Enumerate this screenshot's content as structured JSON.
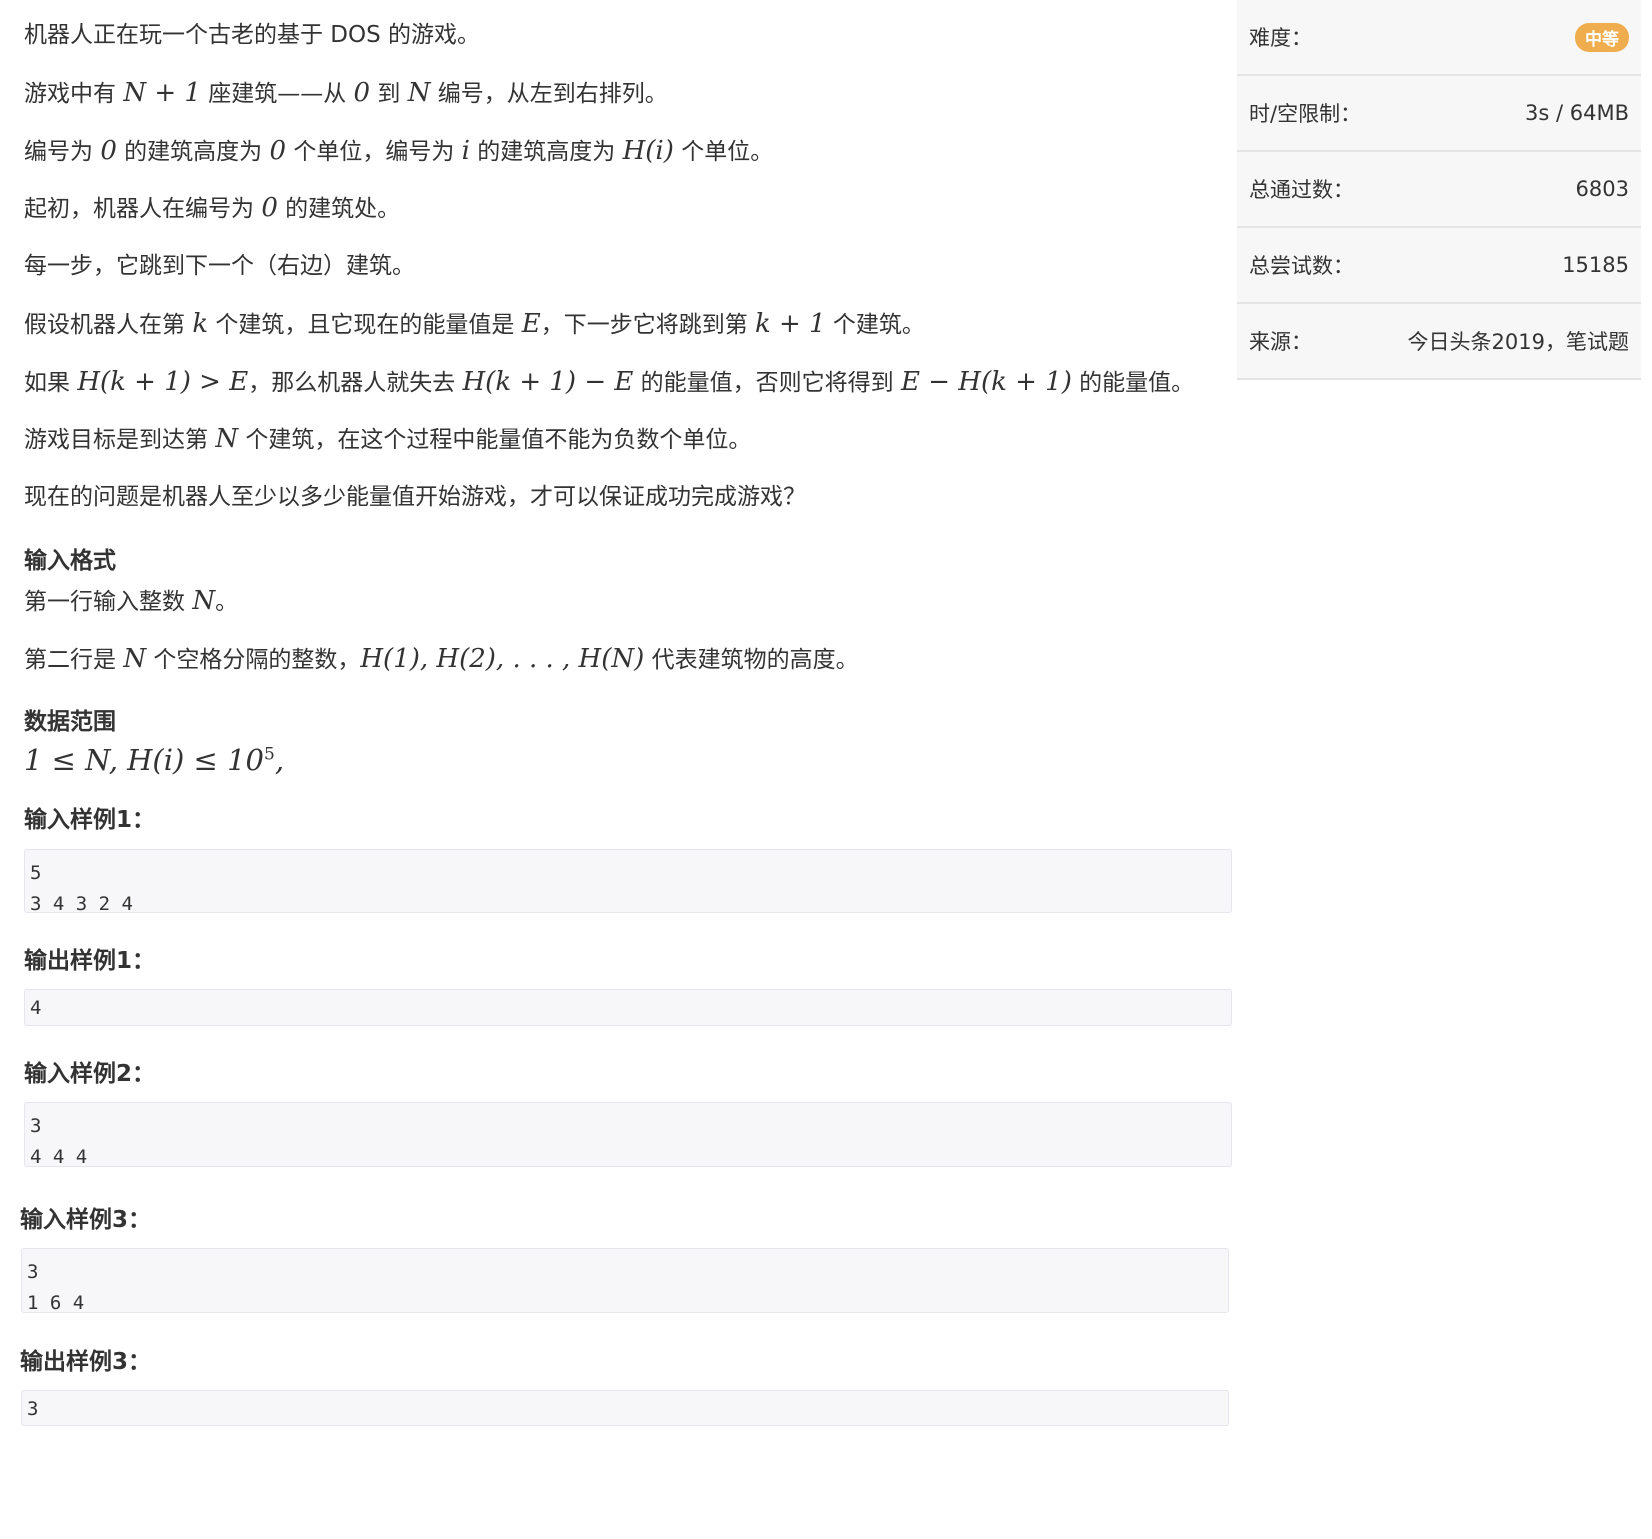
{
  "problem": {
    "p1": "机器人正在玩一个古老的基于 DOS 的游戏。",
    "p2_a": "游戏中有 ",
    "p2_m1": "N + 1",
    "p2_b": " 座建筑——从 ",
    "p2_m2": "0",
    "p2_c": " 到 ",
    "p2_m3": "N",
    "p2_d": " 编号，从左到右排列。",
    "p3_a": "编号为 ",
    "p3_m1": "0",
    "p3_b": " 的建筑高度为 ",
    "p3_m2": "0",
    "p3_c": " 个单位，编号为 ",
    "p3_m3": "i",
    "p3_d": " 的建筑高度为 ",
    "p3_m4": "H(i)",
    "p3_e": " 个单位。",
    "p4_a": "起初，机器人在编号为 ",
    "p4_m1": "0",
    "p4_b": " 的建筑处。",
    "p5": "每一步，它跳到下一个（右边）建筑。",
    "p6_a": "假设机器人在第 ",
    "p6_m1": "k",
    "p6_b": " 个建筑，且它现在的能量值是 ",
    "p6_m2": "E",
    "p6_c": "，下一步它将跳到第 ",
    "p6_m3": "k + 1",
    "p6_d": " 个建筑。",
    "p7_a": "如果 ",
    "p7_m1": "H(k + 1) > E",
    "p7_b": "，那么机器人就失去 ",
    "p7_m2": "H(k + 1) − E",
    "p7_c": " 的能量值，否则它将得到 ",
    "p7_m3": "E − H(k + 1)",
    "p7_d": " 的能量值。",
    "p8_a": "游戏目标是到达第 ",
    "p8_m1": "N",
    "p8_b": " 个建筑，在这个过程中能量值不能为负数个单位。",
    "p9": "现在的问题是机器人至少以多少能量值开始游戏，才可以保证成功完成游戏？",
    "h_input": "输入格式",
    "in1_a": "第一行输入整数 ",
    "in1_m1": "N",
    "in1_b": "。",
    "in2_a": "第二行是 ",
    "in2_m1": "N",
    "in2_b": " 个空格分隔的整数，",
    "in2_m2": "H(1), H(2), . . . , H(N)",
    "in2_c": " 代表建筑物的高度。",
    "h_range": "数据范围",
    "range_main": "1 ≤ N, H(i) ≤ 10",
    "range_sup": "5",
    "range_end": ",",
    "h_sample_in1": "输入样例1：",
    "sample_in1": "5\n3 4 3 2 4",
    "h_sample_out1": "输出样例1：",
    "sample_out1": "4",
    "h_sample_in2": "输入样例2：",
    "sample_in2": "3\n4 4 4",
    "h_sample_in3": "输入样例3：",
    "sample_in3": "3\n1 6 4",
    "h_sample_out3": "输出样例3：",
    "sample_out3": "3"
  },
  "sidebar": {
    "difficulty_label": "难度：",
    "difficulty_value": "中等",
    "limit_label": "时/空限制：",
    "limit_value": "3s / 64MB",
    "passed_label": "总通过数：",
    "passed_value": "6803",
    "attempts_label": "总尝试数：",
    "attempts_value": "15185",
    "source_label": "来源：",
    "source_value": "今日头条2019，笔试题"
  },
  "colors": {
    "badge": "#f0ad4e",
    "sidebar_bg": "#f7f7f7",
    "code_bg": "#f7f7f9"
  }
}
